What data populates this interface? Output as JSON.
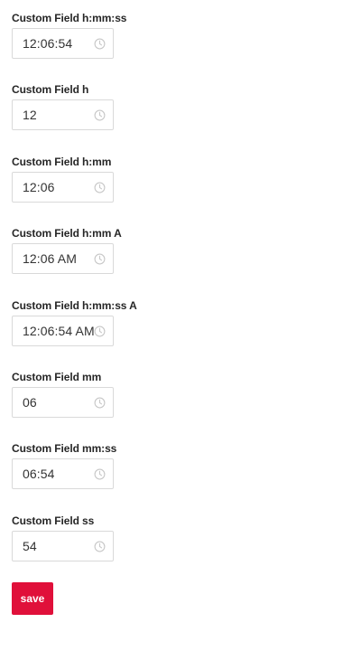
{
  "fields": [
    {
      "label": "Custom Field h:mm:ss",
      "value": "12:06:54",
      "icon": "clock-icon"
    },
    {
      "label": "Custom Field h",
      "value": "12",
      "icon": "clock-icon"
    },
    {
      "label": "Custom Field h:mm",
      "value": "12:06",
      "icon": "clock-icon"
    },
    {
      "label": "Custom Field h:mm A",
      "value": "12:06 AM",
      "icon": "clock-icon"
    },
    {
      "label": "Custom Field h:mm:ss A",
      "value": "12:06:54 AM",
      "icon": "clock-icon"
    },
    {
      "label": "Custom Field mm",
      "value": "06",
      "icon": "clock-icon"
    },
    {
      "label": "Custom Field mm:ss",
      "value": "06:54",
      "icon": "clock-icon"
    },
    {
      "label": "Custom Field ss",
      "value": "54",
      "icon": "clock-icon"
    }
  ],
  "save_label": "save",
  "colors": {
    "accent": "#e0103a",
    "border": "#d9d9d9",
    "icon": "#c8c8c8"
  }
}
